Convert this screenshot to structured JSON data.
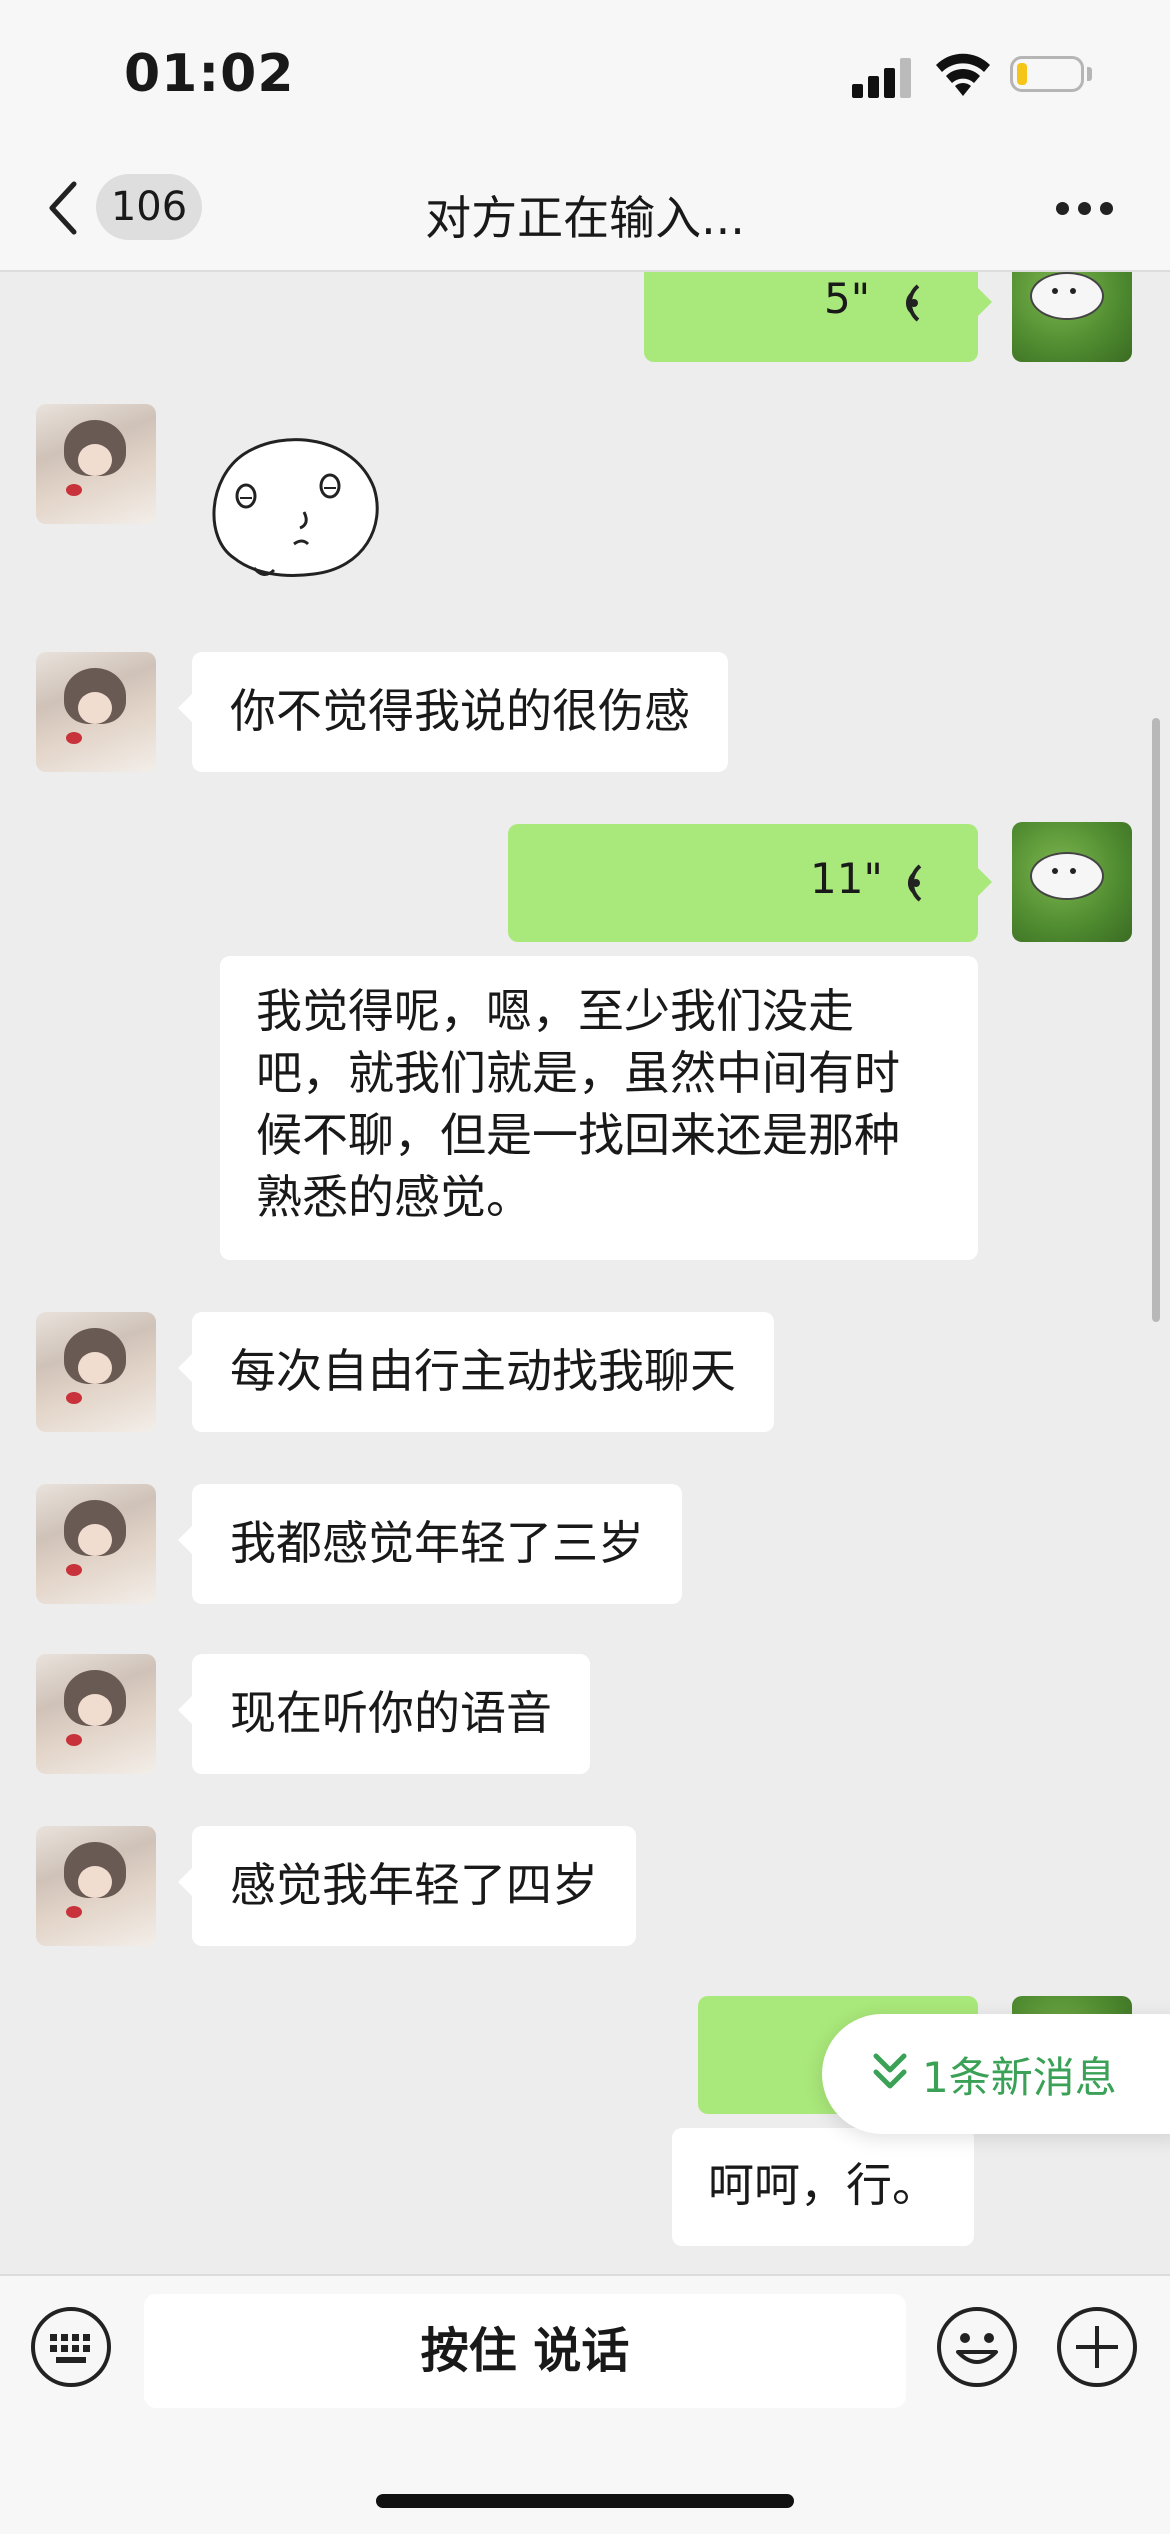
{
  "status_bar": {
    "time": "01:02",
    "battery_level": 0.15,
    "battery_color": "#f5c518"
  },
  "nav": {
    "back_badge": "106",
    "title": "对方正在输入...",
    "more_icon": "more-dots-icon"
  },
  "messages": [
    {
      "side": "out",
      "type": "voice",
      "duration": "5\""
    },
    {
      "side": "in",
      "type": "sticker"
    },
    {
      "side": "in",
      "type": "text",
      "text": "你不觉得我说的很伤感"
    },
    {
      "side": "out",
      "type": "voice",
      "duration": "11\""
    },
    {
      "side": "out",
      "type": "voice-transcript",
      "lines": [
        "我觉得呢，嗯，至少我们没走",
        "吧，就我们就是，虽然中间有时",
        "候不聊，但是一找回来还是那种",
        "熟悉的感觉。"
      ]
    },
    {
      "side": "in",
      "type": "text",
      "text": "每次自由行主动找我聊天"
    },
    {
      "side": "in",
      "type": "text",
      "text": "我都感觉年轻了三岁"
    },
    {
      "side": "in",
      "type": "text",
      "text": "现在听你的语音"
    },
    {
      "side": "in",
      "type": "text",
      "text": "感觉我年轻了四岁"
    },
    {
      "side": "out",
      "type": "voice",
      "duration": ""
    },
    {
      "side": "out",
      "type": "voice-transcript",
      "lines": [
        "呵呵，行。"
      ]
    }
  ],
  "new_message_pill": {
    "text": "1条新消息"
  },
  "input_bar": {
    "push_to_talk_label": "按住 说话"
  },
  "colors": {
    "outgoing_bubble": "#a9e87a",
    "incoming_bubble": "#ffffff",
    "background": "#ededed",
    "new_msg_accent": "#3aa157"
  }
}
